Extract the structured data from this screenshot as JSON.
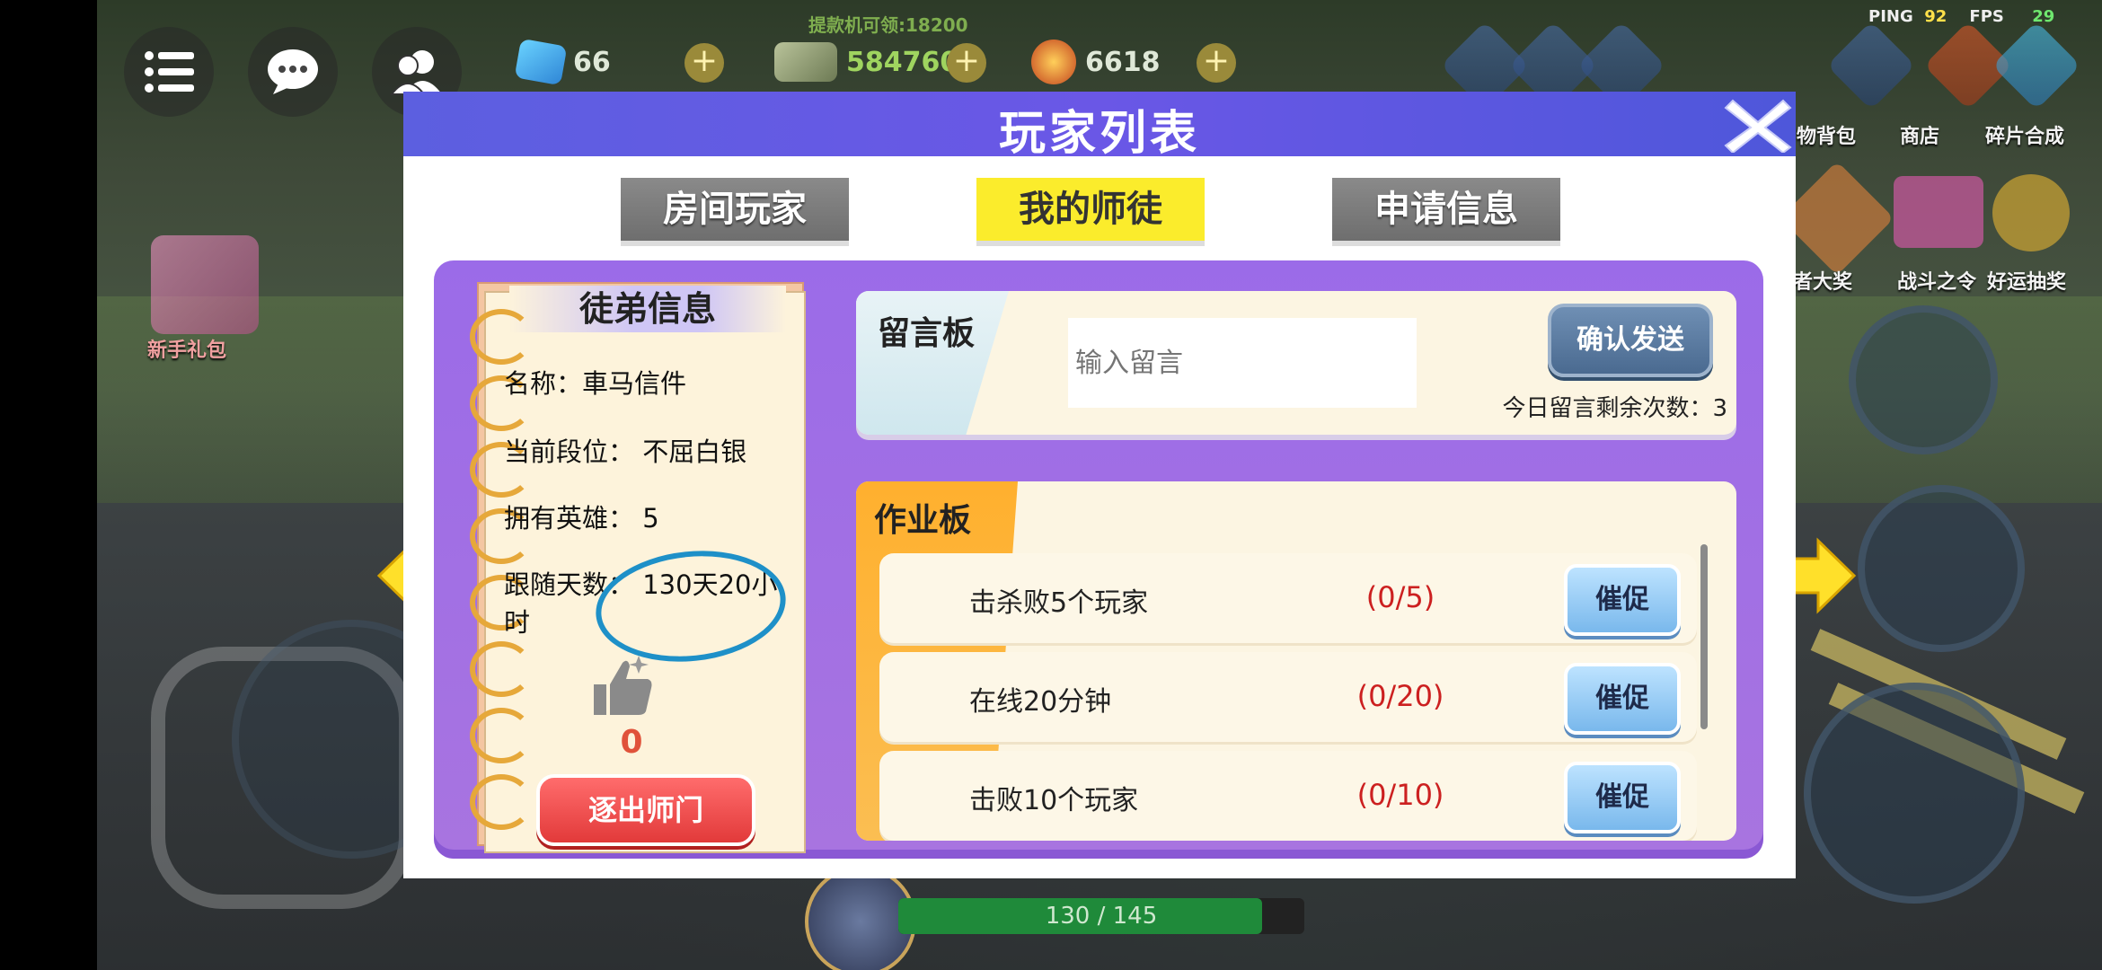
{
  "hud": {
    "withdraw_tip": "提款机可领:18200",
    "gems": "66",
    "cash": "584760",
    "trophies": "6618",
    "ping_label": "PING",
    "ping_value": "92",
    "fps_label": "FPS",
    "fps_value": "29",
    "menu_labels": [
      "物背包",
      "商店",
      "碎片合成",
      "者大奖",
      "战斗之令",
      "好运抽奖"
    ],
    "newbie_gift": "新手礼包",
    "hp_text": "130 / 145",
    "hp_fraction": 0.897
  },
  "panel": {
    "title": "玩家列表",
    "tabs": [
      {
        "label": "房间玩家",
        "active": false
      },
      {
        "label": "我的师徒",
        "active": true
      },
      {
        "label": "申请信息",
        "active": false
      }
    ]
  },
  "apprentice": {
    "title": "徒弟信息",
    "name": "名称：車马信件",
    "rank": "当前段位：  不屈白银",
    "heroes": "拥有英雄：  5",
    "days": "跟随天数：  130天20小时",
    "likes": "0",
    "expel_label": "逐出师门"
  },
  "message_board": {
    "title": "留言板",
    "placeholder": "输入留言",
    "send_label": "确认发送",
    "remaining": "今日留言剩余次数：3"
  },
  "homework": {
    "title": "作业板",
    "tasks": [
      {
        "name": "击杀败5个玩家",
        "progress": "(0/5)",
        "button": "催促"
      },
      {
        "name": "在线20分钟",
        "progress": "(0/20)",
        "button": "催促"
      },
      {
        "name": "击败10个玩家",
        "progress": "(0/10)",
        "button": "催促"
      }
    ]
  },
  "colors": {
    "panel_header": "#5c5fe0",
    "active_tab": "#fbec2c",
    "inner_panel": "#9b6be8",
    "progress_red": "#cc2020",
    "circle_annotation": "#1e90c8"
  }
}
